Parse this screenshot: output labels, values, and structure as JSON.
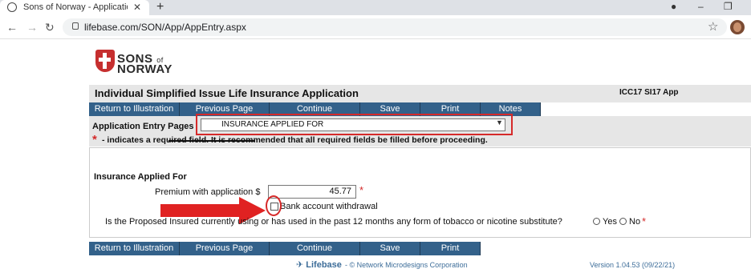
{
  "browser": {
    "tab_title": "Sons of Norway - Application Inf",
    "tab_close": "✕",
    "new_tab": "+",
    "url": "lifebase.com/SON/App/AppEntry.aspx"
  },
  "logo": {
    "line1": "SONS",
    "of": "of",
    "line2": "NORWAY"
  },
  "form": {
    "title": "Individual Simplified Issue Life Insurance Application",
    "code": "ICC17 SI17 App",
    "top_buttons": [
      "Return to Illustration",
      "Previous Page",
      "Continue",
      "Save",
      "Print",
      "Notes"
    ],
    "bottom_buttons": [
      "Return to Illustration",
      "Previous Page",
      "Continue",
      "Save",
      "Print"
    ],
    "entry_pages_label": "Application Entry Pages",
    "entry_pages_selected": "INSURANCE APPLIED FOR",
    "required_star": "*",
    "required_note": "- indicates a required field. It is recommended that all required fields be filled before proceeding.",
    "section_title": "Insurance Applied For",
    "premium_label": "Premium with application $",
    "premium_value": "45.77",
    "bank_withdrawal_label": "Bank account withdrawal",
    "tobacco_question": "Is the Proposed Insured currently using or has used in the past 12 months any form of tobacco or nicotine substitute?",
    "yes_label": "Yes",
    "no_label": "No"
  },
  "footer": {
    "logo": "Lifebase",
    "copyright": "-  © Network Microdesigns Corporation",
    "version": "Version 1.04.53 (09/22/21)"
  },
  "colors": {
    "button_bg": "#33618a",
    "annotation_red": "#d62a2a",
    "footer_blue": "#3d6d99"
  }
}
